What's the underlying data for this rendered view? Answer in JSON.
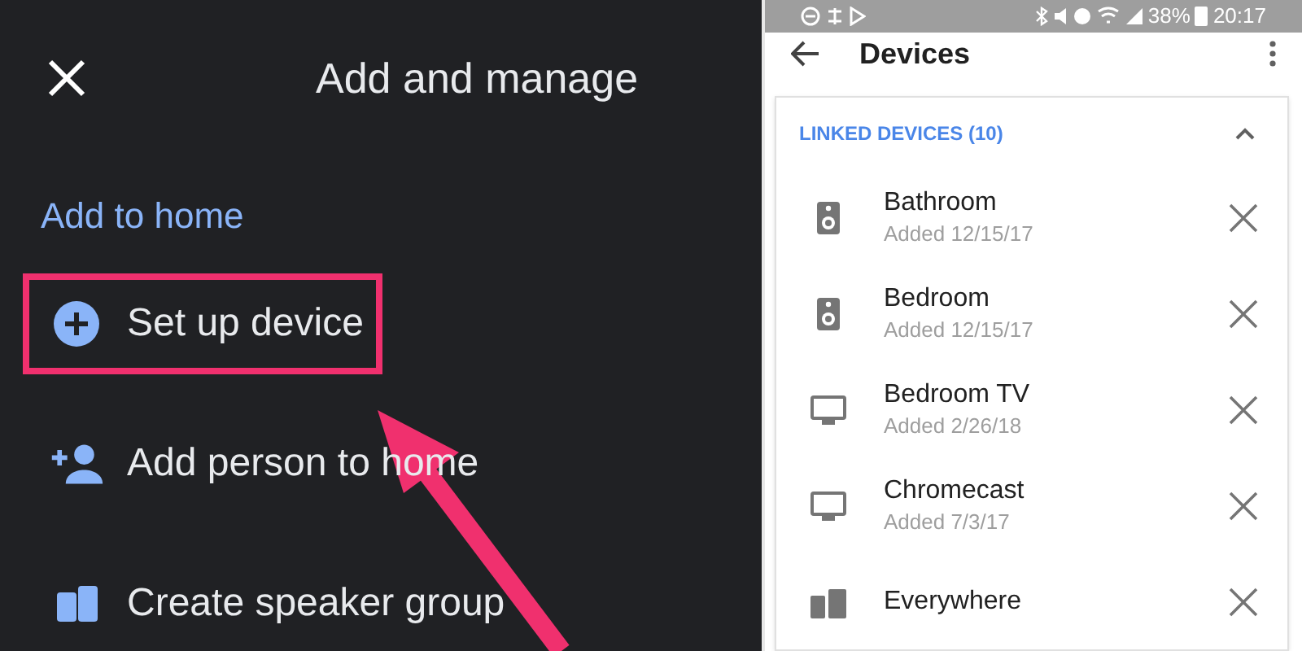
{
  "left_panel": {
    "title": "Add and manage",
    "section_title": "Add to home",
    "items": [
      {
        "kind": "add-device",
        "label": "Set up device",
        "highlighted": true
      },
      {
        "kind": "add-person",
        "label": "Add person to home",
        "highlighted": false
      },
      {
        "kind": "speaker-group",
        "label": "Create speaker group",
        "highlighted": false
      }
    ]
  },
  "status_bar": {
    "battery": "38%",
    "time": "20:17"
  },
  "app_bar": {
    "title": "Devices"
  },
  "linked_devices": {
    "title": "LINKED DEVICES (10)",
    "expanded": true,
    "devices": [
      {
        "kind": "speaker",
        "name": "Bathroom",
        "added": "Added 12/15/17"
      },
      {
        "kind": "speaker",
        "name": "Bedroom",
        "added": "Added 12/15/17"
      },
      {
        "kind": "tv",
        "name": "Bedroom TV",
        "added": "Added 2/26/18"
      },
      {
        "kind": "tv",
        "name": "Chromecast",
        "added": "Added 7/3/17"
      },
      {
        "kind": "group",
        "name": "Everywhere"
      }
    ]
  }
}
